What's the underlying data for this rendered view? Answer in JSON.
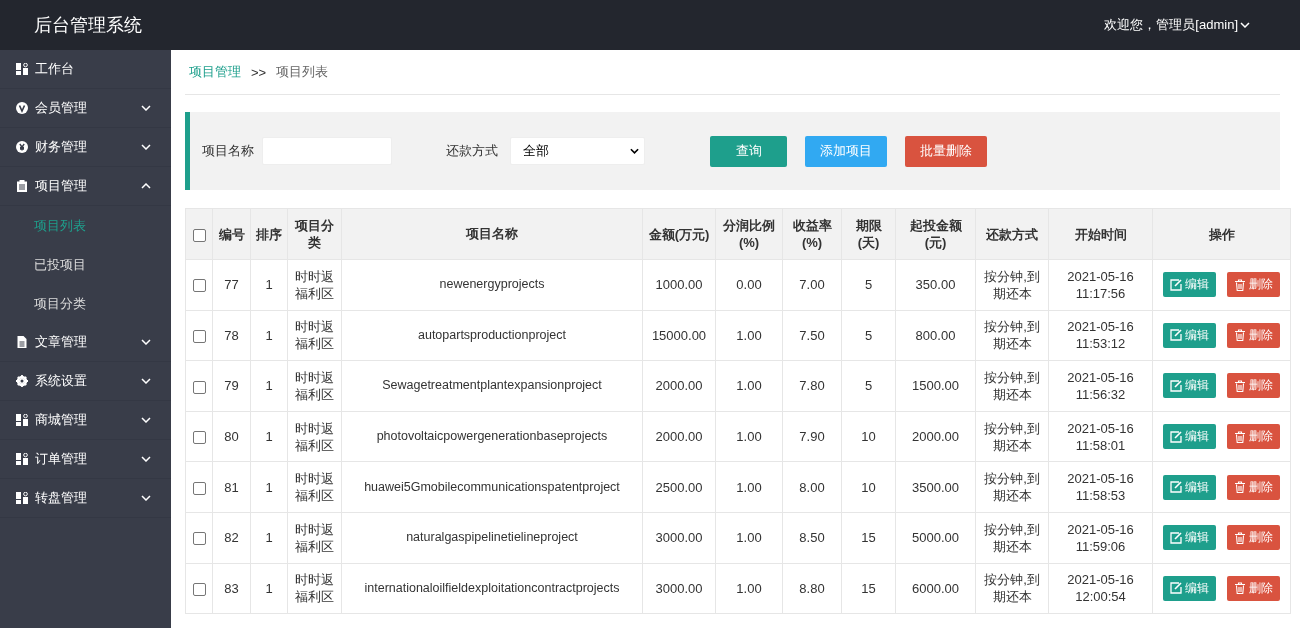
{
  "header": {
    "title": "后台管理系统",
    "user": "欢迎您，管理员[admin]"
  },
  "sidebar": {
    "items": [
      {
        "label": "工作台"
      },
      {
        "label": "会员管理",
        "expanded": false
      },
      {
        "label": "财务管理",
        "expanded": false
      },
      {
        "label": "项目管理",
        "expanded": true,
        "children": [
          {
            "label": "项目列表",
            "selected": true
          },
          {
            "label": "已投项目",
            "selected": false
          },
          {
            "label": "项目分类",
            "selected": false
          }
        ]
      },
      {
        "label": "文章管理",
        "expanded": false
      },
      {
        "label": "系统设置",
        "expanded": false
      },
      {
        "label": "商城管理",
        "expanded": false
      },
      {
        "label": "订单管理",
        "expanded": false
      },
      {
        "label": "转盘管理",
        "expanded": false
      }
    ]
  },
  "breadcrumb": {
    "parent": "项目管理",
    "separator": ">>",
    "current": "项目列表"
  },
  "filters": {
    "name_label": "项目名称",
    "repay_label": "还款方式",
    "repay_value": "全部",
    "buttons": [
      {
        "label": "查询",
        "kind": "query"
      },
      {
        "label": "添加项目",
        "kind": "add"
      },
      {
        "label": "批量删除",
        "kind": "delete"
      }
    ]
  },
  "table": {
    "columns": [
      "编号",
      "排序",
      "项目分类",
      "项目名称",
      "金额(万元)",
      "分润比例(%)",
      "收益率(%)",
      "期限(天)",
      "起投金额(元)",
      "还款方式",
      "开始时间",
      "操作"
    ],
    "select_all": {
      "checked": false
    },
    "rows": [
      {
        "checked": false,
        "actions": [
          "编辑",
          "删除"
        ],
        "cells": [
          "77",
          "1",
          "时时返福利区",
          "newenergyprojects",
          "1000.00",
          "0.00",
          "7.00",
          "5",
          "350.00",
          "按分钟,到期还本",
          "2021-05-16 11:17:56"
        ]
      },
      {
        "checked": false,
        "actions": [
          "编辑",
          "删除"
        ],
        "cells": [
          "78",
          "1",
          "时时返福利区",
          "autopartsproductionproject",
          "15000.00",
          "1.00",
          "7.50",
          "5",
          "800.00",
          "按分钟,到期还本",
          "2021-05-16 11:53:12"
        ]
      },
      {
        "checked": false,
        "actions": [
          "编辑",
          "删除"
        ],
        "cells": [
          "79",
          "1",
          "时时返福利区",
          "Sewagetreatmentplantexpansionproject",
          "2000.00",
          "1.00",
          "7.80",
          "5",
          "1500.00",
          "按分钟,到期还本",
          "2021-05-16 11:56:32"
        ]
      },
      {
        "checked": false,
        "actions": [
          "编辑",
          "删除"
        ],
        "cells": [
          "80",
          "1",
          "时时返福利区",
          "photovoltaicpowergenerationbaseprojects",
          "2000.00",
          "1.00",
          "7.90",
          "10",
          "2000.00",
          "按分钟,到期还本",
          "2021-05-16 11:58:01"
        ]
      },
      {
        "checked": false,
        "actions": [
          "编辑",
          "删除"
        ],
        "cells": [
          "81",
          "1",
          "时时返福利区",
          "huawei5Gmobilecommunicationspatentproject",
          "2500.00",
          "1.00",
          "8.00",
          "10",
          "3500.00",
          "按分钟,到期还本",
          "2021-05-16 11:58:53"
        ]
      },
      {
        "checked": false,
        "actions": [
          "编辑",
          "删除"
        ],
        "cells": [
          "82",
          "1",
          "时时返福利区",
          "naturalgaspipelinetielineproject",
          "3000.00",
          "1.00",
          "8.50",
          "15",
          "5000.00",
          "按分钟,到期还本",
          "2021-05-16 11:59:06"
        ]
      },
      {
        "checked": false,
        "actions": [
          "编辑",
          "删除"
        ],
        "cells": [
          "83",
          "1",
          "时时返福利区",
          "internationaloilfieldexploitationcontractprojects",
          "3000.00",
          "1.00",
          "8.80",
          "15",
          "6000.00",
          "按分钟,到期还本",
          "2021-05-16 12:00:54"
        ]
      }
    ]
  }
}
